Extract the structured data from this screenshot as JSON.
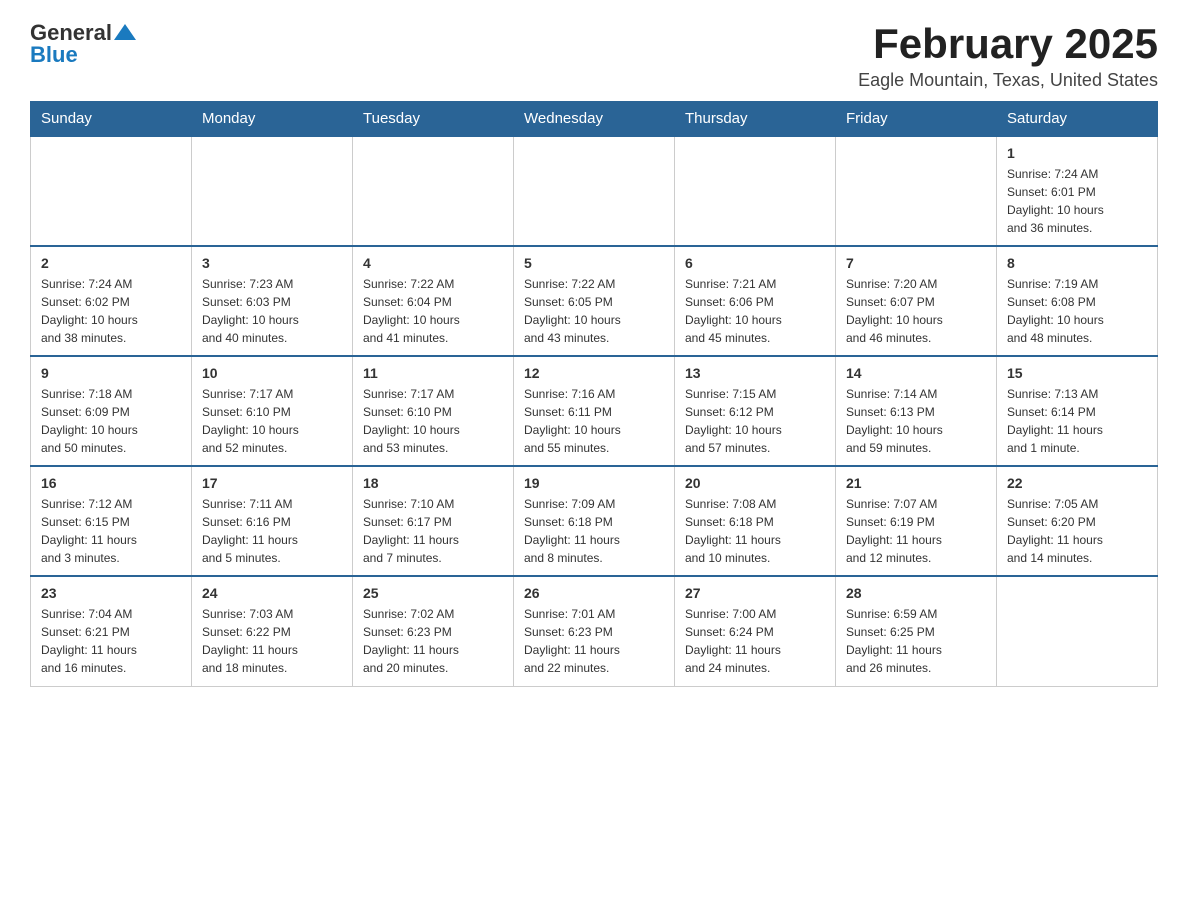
{
  "logo": {
    "text_general": "General",
    "text_blue": "Blue"
  },
  "title": "February 2025",
  "location": "Eagle Mountain, Texas, United States",
  "days_of_week": [
    "Sunday",
    "Monday",
    "Tuesday",
    "Wednesday",
    "Thursday",
    "Friday",
    "Saturday"
  ],
  "weeks": [
    [
      {
        "day": "",
        "info": ""
      },
      {
        "day": "",
        "info": ""
      },
      {
        "day": "",
        "info": ""
      },
      {
        "day": "",
        "info": ""
      },
      {
        "day": "",
        "info": ""
      },
      {
        "day": "",
        "info": ""
      },
      {
        "day": "1",
        "info": "Sunrise: 7:24 AM\nSunset: 6:01 PM\nDaylight: 10 hours\nand 36 minutes."
      }
    ],
    [
      {
        "day": "2",
        "info": "Sunrise: 7:24 AM\nSunset: 6:02 PM\nDaylight: 10 hours\nand 38 minutes."
      },
      {
        "day": "3",
        "info": "Sunrise: 7:23 AM\nSunset: 6:03 PM\nDaylight: 10 hours\nand 40 minutes."
      },
      {
        "day": "4",
        "info": "Sunrise: 7:22 AM\nSunset: 6:04 PM\nDaylight: 10 hours\nand 41 minutes."
      },
      {
        "day": "5",
        "info": "Sunrise: 7:22 AM\nSunset: 6:05 PM\nDaylight: 10 hours\nand 43 minutes."
      },
      {
        "day": "6",
        "info": "Sunrise: 7:21 AM\nSunset: 6:06 PM\nDaylight: 10 hours\nand 45 minutes."
      },
      {
        "day": "7",
        "info": "Sunrise: 7:20 AM\nSunset: 6:07 PM\nDaylight: 10 hours\nand 46 minutes."
      },
      {
        "day": "8",
        "info": "Sunrise: 7:19 AM\nSunset: 6:08 PM\nDaylight: 10 hours\nand 48 minutes."
      }
    ],
    [
      {
        "day": "9",
        "info": "Sunrise: 7:18 AM\nSunset: 6:09 PM\nDaylight: 10 hours\nand 50 minutes."
      },
      {
        "day": "10",
        "info": "Sunrise: 7:17 AM\nSunset: 6:10 PM\nDaylight: 10 hours\nand 52 minutes."
      },
      {
        "day": "11",
        "info": "Sunrise: 7:17 AM\nSunset: 6:10 PM\nDaylight: 10 hours\nand 53 minutes."
      },
      {
        "day": "12",
        "info": "Sunrise: 7:16 AM\nSunset: 6:11 PM\nDaylight: 10 hours\nand 55 minutes."
      },
      {
        "day": "13",
        "info": "Sunrise: 7:15 AM\nSunset: 6:12 PM\nDaylight: 10 hours\nand 57 minutes."
      },
      {
        "day": "14",
        "info": "Sunrise: 7:14 AM\nSunset: 6:13 PM\nDaylight: 10 hours\nand 59 minutes."
      },
      {
        "day": "15",
        "info": "Sunrise: 7:13 AM\nSunset: 6:14 PM\nDaylight: 11 hours\nand 1 minute."
      }
    ],
    [
      {
        "day": "16",
        "info": "Sunrise: 7:12 AM\nSunset: 6:15 PM\nDaylight: 11 hours\nand 3 minutes."
      },
      {
        "day": "17",
        "info": "Sunrise: 7:11 AM\nSunset: 6:16 PM\nDaylight: 11 hours\nand 5 minutes."
      },
      {
        "day": "18",
        "info": "Sunrise: 7:10 AM\nSunset: 6:17 PM\nDaylight: 11 hours\nand 7 minutes."
      },
      {
        "day": "19",
        "info": "Sunrise: 7:09 AM\nSunset: 6:18 PM\nDaylight: 11 hours\nand 8 minutes."
      },
      {
        "day": "20",
        "info": "Sunrise: 7:08 AM\nSunset: 6:18 PM\nDaylight: 11 hours\nand 10 minutes."
      },
      {
        "day": "21",
        "info": "Sunrise: 7:07 AM\nSunset: 6:19 PM\nDaylight: 11 hours\nand 12 minutes."
      },
      {
        "day": "22",
        "info": "Sunrise: 7:05 AM\nSunset: 6:20 PM\nDaylight: 11 hours\nand 14 minutes."
      }
    ],
    [
      {
        "day": "23",
        "info": "Sunrise: 7:04 AM\nSunset: 6:21 PM\nDaylight: 11 hours\nand 16 minutes."
      },
      {
        "day": "24",
        "info": "Sunrise: 7:03 AM\nSunset: 6:22 PM\nDaylight: 11 hours\nand 18 minutes."
      },
      {
        "day": "25",
        "info": "Sunrise: 7:02 AM\nSunset: 6:23 PM\nDaylight: 11 hours\nand 20 minutes."
      },
      {
        "day": "26",
        "info": "Sunrise: 7:01 AM\nSunset: 6:23 PM\nDaylight: 11 hours\nand 22 minutes."
      },
      {
        "day": "27",
        "info": "Sunrise: 7:00 AM\nSunset: 6:24 PM\nDaylight: 11 hours\nand 24 minutes."
      },
      {
        "day": "28",
        "info": "Sunrise: 6:59 AM\nSunset: 6:25 PM\nDaylight: 11 hours\nand 26 minutes."
      },
      {
        "day": "",
        "info": ""
      }
    ]
  ]
}
